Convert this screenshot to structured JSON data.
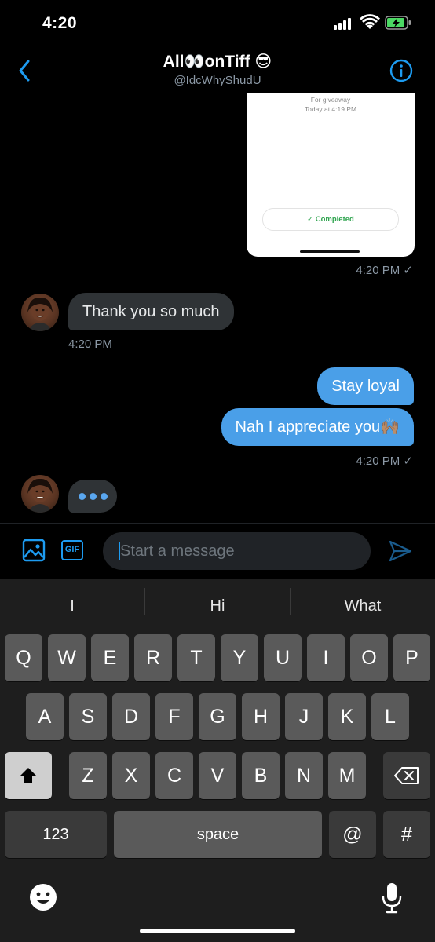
{
  "status_bar": {
    "time": "4:20"
  },
  "header": {
    "title": "All👀onTiff 😎",
    "handle": "@IdcWhyShudU"
  },
  "receipt": {
    "note": "For giveaway",
    "date": "Today at 4:19 PM",
    "status": "✓ Completed"
  },
  "messages": [
    {
      "direction": "out",
      "kind": "image",
      "timestamp": "4:20 PM ✓"
    },
    {
      "direction": "in",
      "text": "Thank you so much",
      "timestamp": "4:20 PM"
    },
    {
      "direction": "out",
      "text": "Stay loyal"
    },
    {
      "direction": "out",
      "text": "Nah I appreciate you🙌🏽",
      "timestamp": "4:20 PM ✓"
    },
    {
      "direction": "in",
      "kind": "typing-indicator"
    }
  ],
  "composer": {
    "placeholder": "Start a message",
    "gif_label": "GIF"
  },
  "keyboard": {
    "suggestions": [
      "I",
      "Hi",
      "What"
    ],
    "row1": [
      "Q",
      "W",
      "E",
      "R",
      "T",
      "Y",
      "U",
      "I",
      "O",
      "P"
    ],
    "row2": [
      "A",
      "S",
      "D",
      "F",
      "G",
      "H",
      "J",
      "K",
      "L"
    ],
    "row3": [
      "Z",
      "X",
      "C",
      "V",
      "B",
      "N",
      "M"
    ],
    "numbers_label": "123",
    "space_label": "space",
    "at_label": "@",
    "hash_label": "#"
  },
  "colors": {
    "accent": "#1d9bf0",
    "outgoing_bubble": "#4a9fe8",
    "incoming_bubble": "#2f3336",
    "completed_green": "#2fa44f"
  }
}
